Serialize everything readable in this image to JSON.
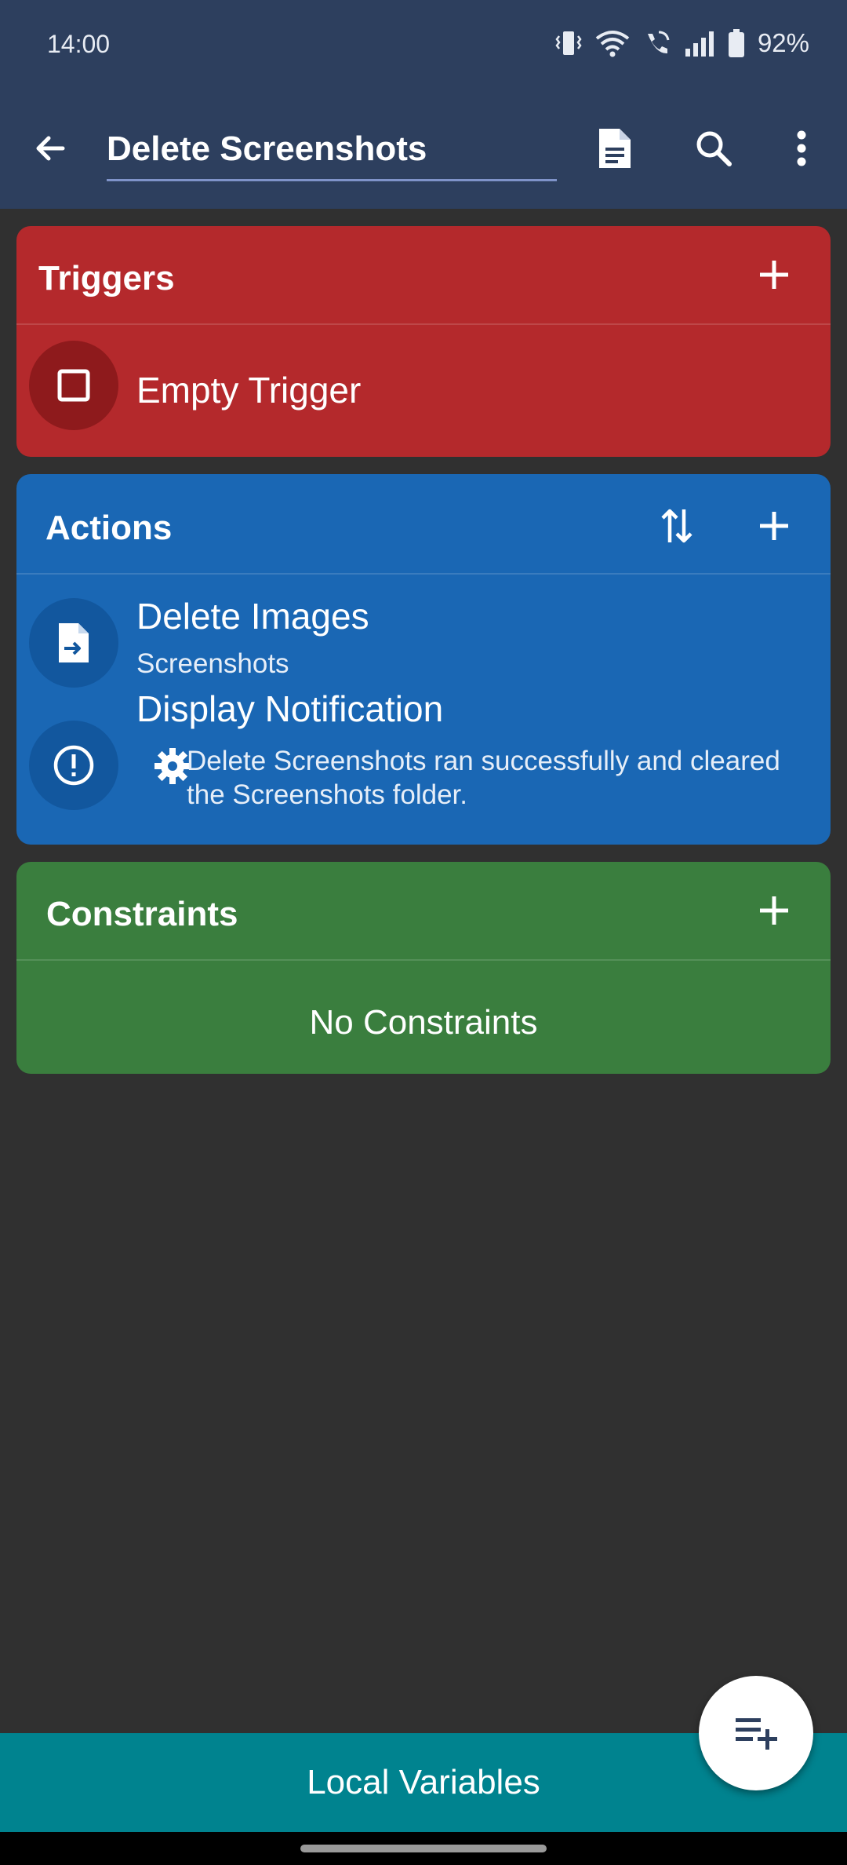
{
  "status_bar": {
    "time": "14:00",
    "battery": "92%",
    "icons": [
      "vibrate-icon",
      "wifi-icon",
      "wifi-calling-icon",
      "signal-icon",
      "battery-icon"
    ]
  },
  "app_bar": {
    "title_value": "Delete Screenshots",
    "icons": [
      "back-arrow-icon",
      "document-icon",
      "search-icon",
      "more-vert-icon"
    ]
  },
  "triggers": {
    "title": "Triggers",
    "color": "#b4292c",
    "items": [
      {
        "title": "Empty Trigger",
        "icon": "checkbox-square-icon"
      }
    ]
  },
  "actions": {
    "title": "Actions",
    "color": "#1a67b4",
    "items": [
      {
        "title": "Delete Images",
        "subtitle": "Screenshots",
        "icon": "file-move-icon"
      },
      {
        "title": "Display Notification",
        "subtitle": "Delete Screenshots ran successfully and cleared the Screenshots folder.",
        "icon": "exclamation-circle-icon",
        "sub_icon": "gear-icon"
      }
    ]
  },
  "constraints": {
    "title": "Constraints",
    "color": "#3a7e3e",
    "empty_text": "No Constraints"
  },
  "bottom": {
    "local_variables_label": "Local Variables",
    "fab_icon": "playlist-add-icon"
  }
}
